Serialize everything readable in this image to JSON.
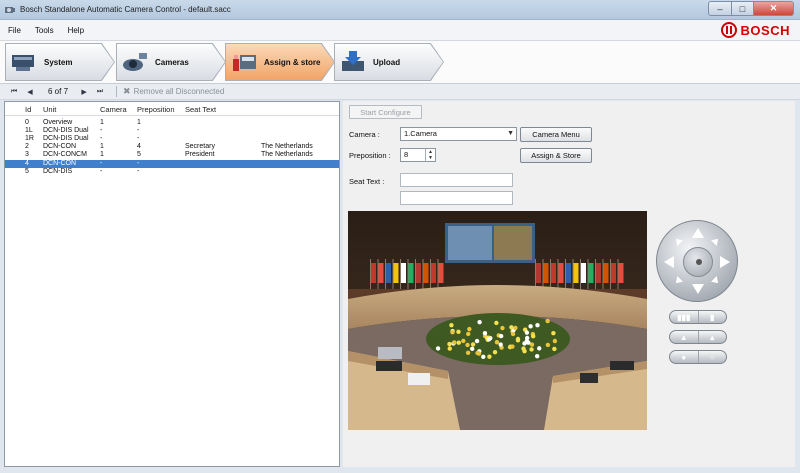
{
  "window": {
    "title": "Bosch Standalone Automatic Camera Control - default.sacc"
  },
  "brand": {
    "name": "BOSCH",
    "color": "#d50000"
  },
  "menu": [
    {
      "label": "File"
    },
    {
      "label": "Tools"
    },
    {
      "label": "Help"
    }
  ],
  "steps": [
    {
      "label": "System",
      "active": false
    },
    {
      "label": "Cameras",
      "active": false
    },
    {
      "label": "Assign & store",
      "active": true
    },
    {
      "label": "Upload",
      "active": false
    }
  ],
  "navigator": {
    "position": "6 of 7",
    "remove_label": "Remove all Disconnected"
  },
  "grid": {
    "headers": {
      "id": "Id",
      "unit": "Unit",
      "camera": "Camera",
      "preposition": "Preposition",
      "seat_text": "Seat Text"
    },
    "rows": [
      {
        "id": "0",
        "unit": "Overview",
        "camera": "1",
        "preposition": "1",
        "seat": "",
        "country": "",
        "selected": false
      },
      {
        "id": "1L",
        "unit": "DCN-DIS Dual",
        "camera": "-",
        "preposition": "-",
        "seat": "",
        "country": "",
        "selected": false
      },
      {
        "id": "1R",
        "unit": "DCN-DIS Dual",
        "camera": "-",
        "preposition": "-",
        "seat": "",
        "country": "",
        "selected": false
      },
      {
        "id": "2",
        "unit": "DCN-CON",
        "camera": "1",
        "preposition": "4",
        "seat": "Secretary",
        "country": "The Netherlands",
        "selected": false
      },
      {
        "id": "3",
        "unit": "DCN-CONCM",
        "camera": "1",
        "preposition": "5",
        "seat": "President",
        "country": "The Netherlands",
        "selected": false
      },
      {
        "id": "4",
        "unit": "DCN-CON",
        "camera": "-",
        "preposition": "-",
        "seat": "",
        "country": "",
        "selected": true
      },
      {
        "id": "5",
        "unit": "DCN-DIS",
        "camera": "-",
        "preposition": "-",
        "seat": "",
        "country": "",
        "selected": false
      }
    ]
  },
  "config": {
    "start_label": "Start Configure",
    "camera_label": "Camera :",
    "camera_value": "1.Camera",
    "preposition_label": "Preposition :",
    "preposition_value": "8",
    "seat_text_label": "Seat Text :",
    "camera_menu_label": "Camera Menu",
    "assign_store_label": "Assign & Store"
  },
  "colors": {
    "accent_step": "#f1a467",
    "selection": "#3f7fcb"
  }
}
